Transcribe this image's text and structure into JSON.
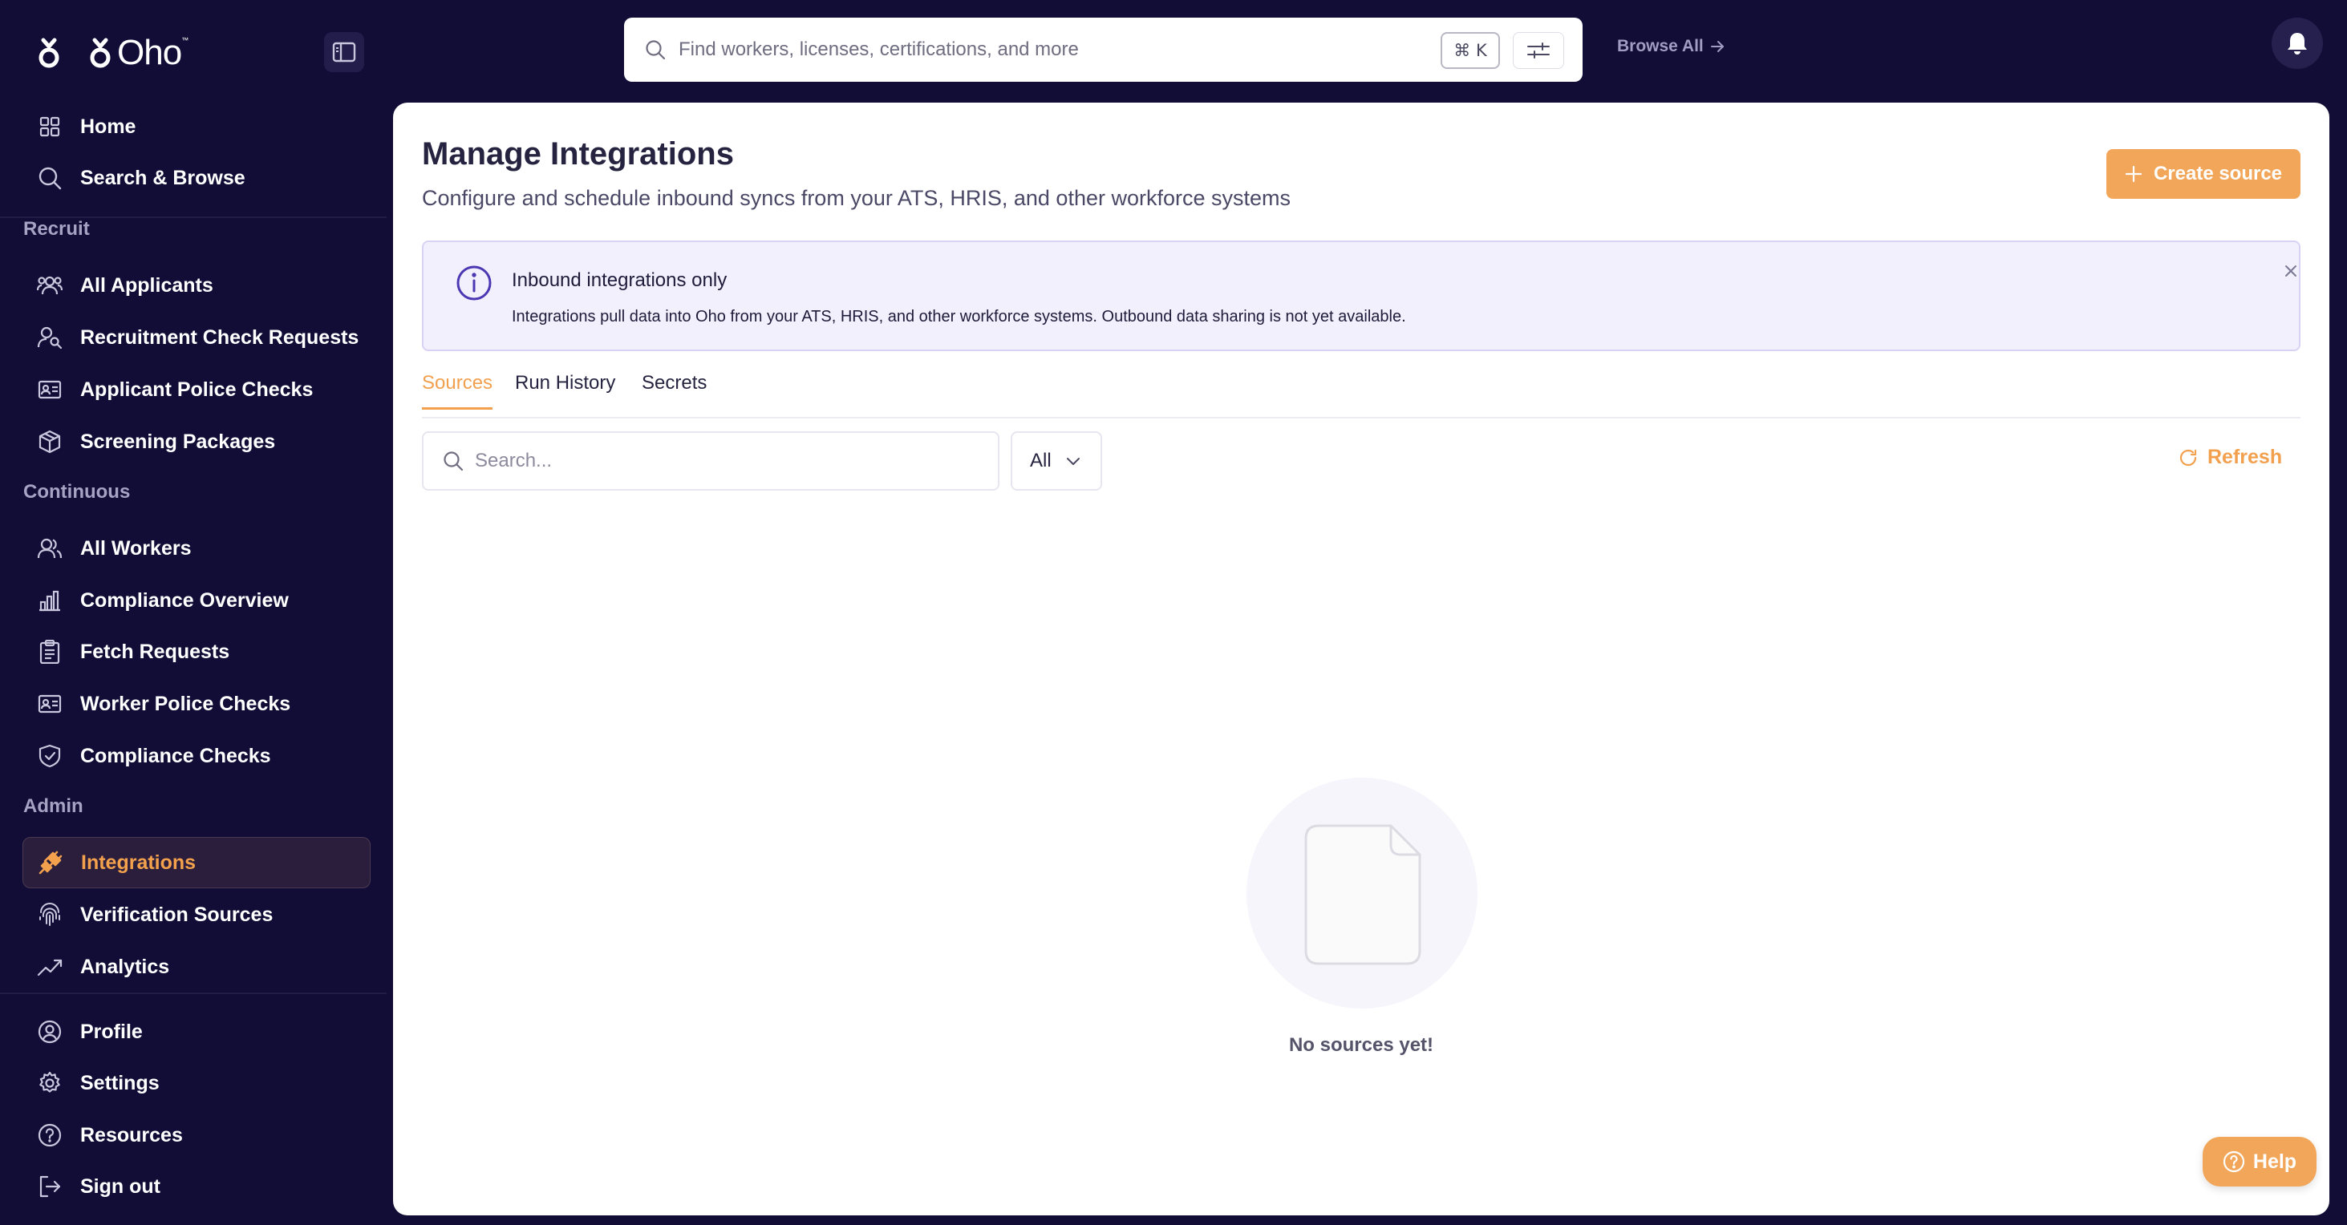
{
  "brand": {
    "name": "Oho",
    "trademark": "™"
  },
  "sidebar": {
    "top_items": [
      {
        "label": "Home",
        "icon": "grid-icon"
      },
      {
        "label": "Search & Browse",
        "icon": "search-icon"
      }
    ],
    "sections": {
      "recruit": "Recruit",
      "continuous": "Continuous",
      "admin": "Admin"
    },
    "recruit_items": [
      {
        "label": "All Applicants",
        "icon": "users-icon"
      },
      {
        "label": "Recruitment Check Requests",
        "icon": "user-search-icon"
      },
      {
        "label": "Applicant Police Checks",
        "icon": "id-card-icon"
      },
      {
        "label": "Screening Packages",
        "icon": "package-icon"
      }
    ],
    "continuous_items": [
      {
        "label": "All Workers",
        "icon": "users-icon"
      },
      {
        "label": "Compliance Overview",
        "icon": "bar-chart-icon"
      },
      {
        "label": "Fetch Requests",
        "icon": "clipboard-icon"
      },
      {
        "label": "Worker Police Checks",
        "icon": "id-card-icon"
      },
      {
        "label": "Compliance Checks",
        "icon": "shield-check-icon"
      }
    ],
    "admin_items": [
      {
        "label": "Integrations",
        "icon": "plug-icon",
        "active": true
      },
      {
        "label": "Verification Sources",
        "icon": "fingerprint-icon"
      },
      {
        "label": "Analytics",
        "icon": "trend-icon"
      }
    ],
    "bottom_items": [
      {
        "label": "Profile",
        "icon": "user-circle-icon"
      },
      {
        "label": "Settings",
        "icon": "gear-icon"
      },
      {
        "label": "Resources",
        "icon": "help-circle-icon"
      },
      {
        "label": "Sign out",
        "icon": "sign-out-icon"
      }
    ]
  },
  "topbar": {
    "search_placeholder": "Find workers, licenses, certifications, and more",
    "shortcut": "⌘ K",
    "browse_all": "Browse All"
  },
  "page": {
    "title": "Manage Integrations",
    "subtitle": "Configure and schedule inbound syncs from your ATS, HRIS, and other workforce systems",
    "create_button": "Create source"
  },
  "alert": {
    "title": "Inbound integrations only",
    "body": "Integrations pull data into Oho from your ATS, HRIS, and other workforce systems. Outbound data sharing is not yet available."
  },
  "tabs": [
    {
      "label": "Sources",
      "active": true
    },
    {
      "label": "Run History",
      "active": false
    },
    {
      "label": "Secrets",
      "active": false
    }
  ],
  "filters": {
    "search_placeholder": "Search...",
    "status_value": "All",
    "refresh_label": "Refresh"
  },
  "empty_state": {
    "message": "No sources yet!"
  },
  "help_button": "Help",
  "colors": {
    "sidebar_bg": "#120d36",
    "accent": "#f2a04e",
    "alert_bg": "#f3f0fd",
    "alert_icon": "#4b38b3"
  }
}
